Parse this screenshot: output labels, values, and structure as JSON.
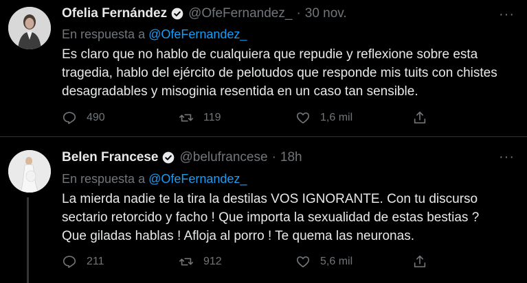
{
  "tweets": [
    {
      "author_name": "Ofelia Fernández",
      "handle": "@OfeFernandez_",
      "separator": "·",
      "time": "30 nov.",
      "reply_prefix": "En respuesta a",
      "reply_mention": "@OfeFernandez_",
      "text": "Es claro que no hablo de cualquiera que repudie y reflexione sobre esta\ntragedia, hablo del ejército de pelotudos que responde mis tuits con chistes\ndesagradables y misoginia resentida en un caso tan sensible.",
      "replies": "490",
      "retweets": "119",
      "likes": "1,6 mil"
    },
    {
      "author_name": "Belen Francese",
      "handle": "@belufrancese",
      "separator": "·",
      "time": "18h",
      "reply_prefix": "En respuesta a",
      "reply_mention": "@OfeFernandez_",
      "text": "La mierda nadie te la tira la destilas  VOS IGNORANTE. Con tu discurso\nsectario retorcido y facho ! Que importa la sexualidad de estas bestias ?\nQue giladas hablas ! Afloja al porro ! Te quema las neuronas.",
      "replies": "211",
      "retweets": "912",
      "likes": "5,6 mil"
    }
  ],
  "more_label": "···",
  "colors": {
    "background": "#000000",
    "text": "#e7e9ea",
    "muted": "#71767b",
    "accent": "#1d9bf0"
  }
}
